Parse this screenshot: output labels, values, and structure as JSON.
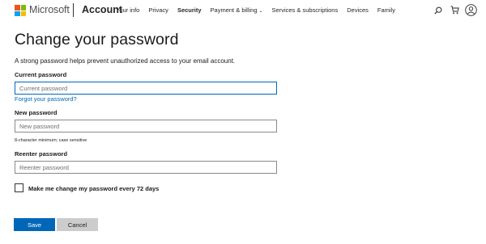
{
  "header": {
    "brand": "Microsoft",
    "account": "Account",
    "nav": [
      {
        "label": "Your info",
        "active": false,
        "dropdown": false
      },
      {
        "label": "Privacy",
        "active": false,
        "dropdown": false
      },
      {
        "label": "Security",
        "active": true,
        "dropdown": false
      },
      {
        "label": "Payment & billing",
        "active": false,
        "dropdown": true
      },
      {
        "label": "Services & subscriptions",
        "active": false,
        "dropdown": false
      },
      {
        "label": "Devices",
        "active": false,
        "dropdown": false
      },
      {
        "label": "Family",
        "active": false,
        "dropdown": false
      }
    ],
    "icons": [
      "search-icon",
      "cart-icon",
      "profile-icon"
    ],
    "logo_colors": [
      "#f25022",
      "#7fba00",
      "#00a4ef",
      "#ffb900"
    ]
  },
  "main": {
    "title": "Change your password",
    "description": "A strong password helps prevent unauthorized access to your email account.",
    "current_password": {
      "label": "Current password",
      "placeholder": "Current password",
      "value": ""
    },
    "forgot_link": "Forgot your password?",
    "new_password": {
      "label": "New password",
      "placeholder": "New password",
      "value": "",
      "hint": "8-character minimum; case sensitive"
    },
    "reenter_password": {
      "label": "Reenter password",
      "placeholder": "Reenter password",
      "value": ""
    },
    "expire_checkbox": {
      "label": "Make me change my password every 72 days",
      "checked": false
    },
    "buttons": {
      "save": "Save",
      "cancel": "Cancel"
    }
  },
  "colors": {
    "accent": "#0067b8",
    "cancel_bg": "#cccccc"
  }
}
